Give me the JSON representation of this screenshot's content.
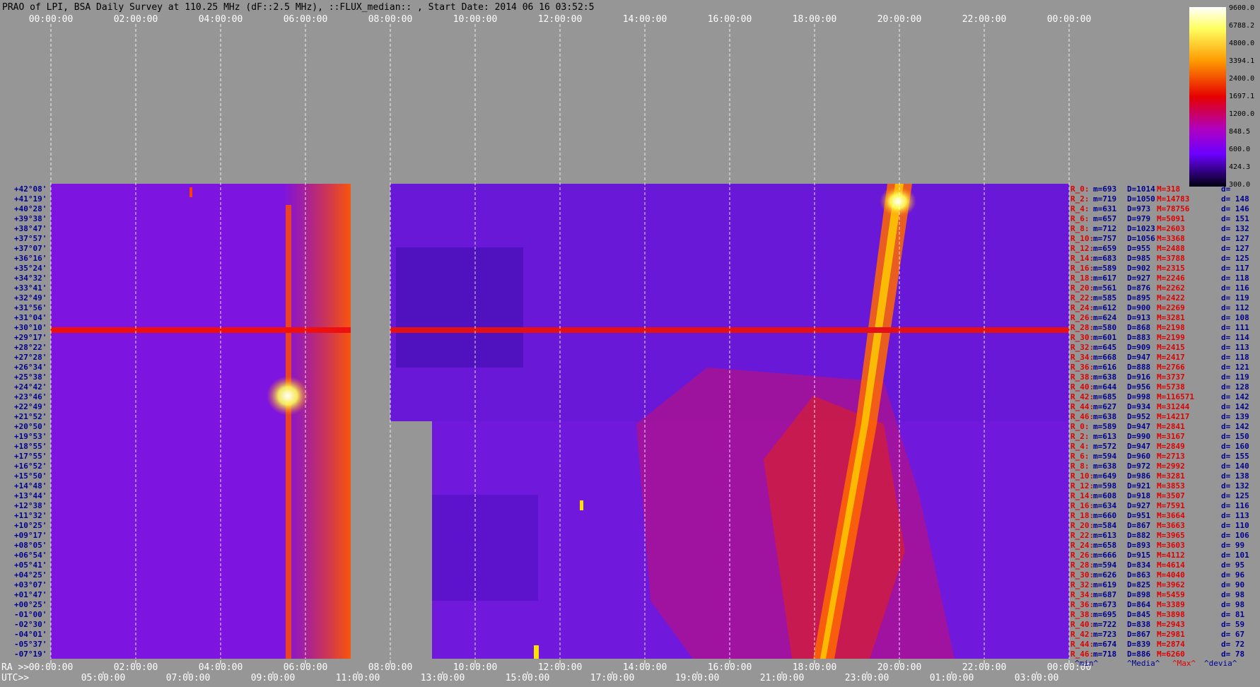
{
  "title": "PRAO of LPI, BSA Daily Survey at 110.25 MHz (dF::2.5 MHz), ::FLUX_median:: , Start Date: 2014 06 16 03:52:5",
  "top_time_ticks": [
    "00:00:00",
    "02:00:00",
    "04:00:00",
    "06:00:00",
    "08:00:00",
    "10:00:00",
    "12:00:00",
    "14:00:00",
    "16:00:00",
    "18:00:00",
    "20:00:00",
    "22:00:00",
    "00:00:00"
  ],
  "bottom": {
    "ra_label": "RA >>",
    "utc_label": "UTC>>",
    "ra_ticks": [
      "00:00:00",
      "02:00:00",
      "04:00:00",
      "06:00:00",
      "08:00:00",
      "10:00:00",
      "12:00:00",
      "14:00:00",
      "16:00:00",
      "18:00:00",
      "20:00:00",
      "22:00:00",
      "00:00:00"
    ],
    "utc_ticks": [
      "05:00:00",
      "07:00:00",
      "09:00:00",
      "11:00:00",
      "13:00:00",
      "15:00:00",
      "17:00:00",
      "19:00:00",
      "21:00:00",
      "23:00:00",
      "01:00:00",
      "03:00:00"
    ]
  },
  "colorbar": {
    "labels": [
      "9600.0",
      "6788.2",
      "4800.0",
      "3394.1",
      "2400.0",
      "1697.1",
      "1200.0",
      "848.5",
      "600.0",
      "424.3",
      "300.0"
    ]
  },
  "stats_footer": {
    "min": "^min^",
    "median": "^Media^",
    "max": "^Max^",
    "devia": "^devia^"
  },
  "colors": {
    "background": "#969696",
    "blue_text": "#000090",
    "red_text": "#e00000",
    "grid": "#ffffff"
  },
  "chart_data": {
    "type": "heatmap",
    "title": "PRAO of LPI, BSA Daily Survey at 110.25 MHz (dF::2.5 MHz), ::FLUX_median:: , Start Date: 2014 06 16 03:52:5",
    "x_axis": "RA (hours), UTC shown below",
    "y_axis": "Declination",
    "color_scale": {
      "min": 300.0,
      "max": 9600.0,
      "scale": "log"
    },
    "declinations": [
      "+42°08'",
      "+41°19'",
      "+40°28'",
      "+39°38'",
      "+38°47'",
      "+37°57'",
      "+37°07'",
      "+36°16'",
      "+35°24'",
      "+34°32'",
      "+33°41'",
      "+32°49'",
      "+31°56'",
      "+31°04'",
      "+30°10'",
      "+29°17'",
      "+28°22'",
      "+27°28'",
      "+26°34'",
      "+25°38'",
      "+24°42'",
      "+23°46'",
      "+22°49'",
      "+21°52'",
      "+20°50'",
      "+19°53'",
      "+18°55'",
      "+17°55'",
      "+16°52'",
      "+15°50'",
      "+14°48'",
      "+13°44'",
      "+12°38'",
      "+11°32'",
      "+10°25'",
      "+09°17'",
      "+08°05'",
      "+06°54'",
      "+05°41'",
      "+04°25'",
      "+03°07'",
      "+01°47'",
      "+00°25'",
      "-01°00'",
      "-02°30'",
      "-04°01'",
      "-05°37'",
      "-07°19'"
    ],
    "beam_stats": [
      {
        "beam": "R_0:",
        "min": "m=693",
        "median": "D=1014",
        "max": "M=318",
        "devia": "d="
      },
      {
        "beam": "R_2:",
        "min": "m=719",
        "median": "D=1050",
        "max": "M=14783",
        "devia": "d= 148"
      },
      {
        "beam": "R_4:",
        "min": "m=631",
        "median": "D=973",
        "max": "M=78756",
        "devia": "d= 146"
      },
      {
        "beam": "R_6:",
        "min": "m=657",
        "median": "D=979",
        "max": "M=5091",
        "devia": "d= 151"
      },
      {
        "beam": "R_8:",
        "min": "m=712",
        "median": "D=1023",
        "max": "M=2603",
        "devia": "d= 132"
      },
      {
        "beam": "R_10:",
        "min": "m=757",
        "median": "D=1056",
        "max": "M=3368",
        "devia": "d= 127"
      },
      {
        "beam": "R_12:",
        "min": "m=659",
        "median": "D=955",
        "max": "M=2488",
        "devia": "d= 127"
      },
      {
        "beam": "R_14:",
        "min": "m=683",
        "median": "D=985",
        "max": "M=3788",
        "devia": "d= 125"
      },
      {
        "beam": "R_16:",
        "min": "m=589",
        "median": "D=902",
        "max": "M=2315",
        "devia": "d= 117"
      },
      {
        "beam": "R_18:",
        "min": "m=617",
        "median": "D=927",
        "max": "M=2246",
        "devia": "d= 118"
      },
      {
        "beam": "R_20:",
        "min": "m=561",
        "median": "D=876",
        "max": "M=2262",
        "devia": "d= 116"
      },
      {
        "beam": "R_22:",
        "min": "m=585",
        "median": "D=895",
        "max": "M=2422",
        "devia": "d= 119"
      },
      {
        "beam": "R_24:",
        "min": "m=612",
        "median": "D=900",
        "max": "M=2269",
        "devia": "d= 112"
      },
      {
        "beam": "R_26:",
        "min": "m=624",
        "median": "D=913",
        "max": "M=3281",
        "devia": "d= 108"
      },
      {
        "beam": "R_28:",
        "min": "m=580",
        "median": "D=868",
        "max": "M=2198",
        "devia": "d= 111"
      },
      {
        "beam": "R_30:",
        "min": "m=601",
        "median": "D=883",
        "max": "M=2199",
        "devia": "d= 114"
      },
      {
        "beam": "R_32:",
        "min": "m=645",
        "median": "D=909",
        "max": "M=2415",
        "devia": "d= 113"
      },
      {
        "beam": "R_34:",
        "min": "m=668",
        "median": "D=947",
        "max": "M=2417",
        "devia": "d= 118"
      },
      {
        "beam": "R_36:",
        "min": "m=616",
        "median": "D=888",
        "max": "M=2766",
        "devia": "d= 121"
      },
      {
        "beam": "R_38:",
        "min": "m=638",
        "median": "D=916",
        "max": "M=3737",
        "devia": "d= 119"
      },
      {
        "beam": "R_40:",
        "min": "m=644",
        "median": "D=956",
        "max": "M=5738",
        "devia": "d= 128"
      },
      {
        "beam": "R_42:",
        "min": "m=685",
        "median": "D=998",
        "max": "M=116571",
        "devia": "d= 142"
      },
      {
        "beam": "R_44:",
        "min": "m=627",
        "median": "D=934",
        "max": "M=31244",
        "devia": "d= 142"
      },
      {
        "beam": "R_46:",
        "min": "m=638",
        "median": "D=952",
        "max": "M=14217",
        "devia": "d= 139"
      },
      {
        "beam": "R_0:",
        "min": "m=589",
        "median": "D=947",
        "max": "M=2841",
        "devia": "d= 142"
      },
      {
        "beam": "R_2:",
        "min": "m=613",
        "median": "D=990",
        "max": "M=3167",
        "devia": "d= 150"
      },
      {
        "beam": "R_4:",
        "min": "m=572",
        "median": "D=947",
        "max": "M=2849",
        "devia": "d= 160"
      },
      {
        "beam": "R_6:",
        "min": "m=594",
        "median": "D=960",
        "max": "M=2713",
        "devia": "d= 155"
      },
      {
        "beam": "R_8:",
        "min": "m=638",
        "median": "D=972",
        "max": "M=2992",
        "devia": "d= 140"
      },
      {
        "beam": "R_10:",
        "min": "m=649",
        "median": "D=986",
        "max": "M=3281",
        "devia": "d= 138"
      },
      {
        "beam": "R_12:",
        "min": "m=598",
        "median": "D=921",
        "max": "M=3853",
        "devia": "d= 132"
      },
      {
        "beam": "R_14:",
        "min": "m=608",
        "median": "D=918",
        "max": "M=3507",
        "devia": "d= 125"
      },
      {
        "beam": "R_16:",
        "min": "m=634",
        "median": "D=927",
        "max": "M=7591",
        "devia": "d= 116"
      },
      {
        "beam": "R_18:",
        "min": "m=660",
        "median": "D=951",
        "max": "M=3664",
        "devia": "d= 113"
      },
      {
        "beam": "R_20:",
        "min": "m=584",
        "median": "D=867",
        "max": "M=3663",
        "devia": "d= 110"
      },
      {
        "beam": "R_22:",
        "min": "m=613",
        "median": "D=882",
        "max": "M=3965",
        "devia": "d= 106"
      },
      {
        "beam": "R_24:",
        "min": "m=658",
        "median": "D=893",
        "max": "M=3603",
        "devia": "d= 99"
      },
      {
        "beam": "R_26:",
        "min": "m=666",
        "median": "D=915",
        "max": "M=4112",
        "devia": "d= 101"
      },
      {
        "beam": "R_28:",
        "min": "m=594",
        "median": "D=834",
        "max": "M=4614",
        "devia": "d= 95"
      },
      {
        "beam": "R_30:",
        "min": "m=626",
        "median": "D=863",
        "max": "M=4040",
        "devia": "d= 96"
      },
      {
        "beam": "R_32:",
        "min": "m=619",
        "median": "D=825",
        "max": "M=3962",
        "devia": "d= 90"
      },
      {
        "beam": "R_34:",
        "min": "m=687",
        "median": "D=898",
        "max": "M=5459",
        "devia": "d= 98"
      },
      {
        "beam": "R_36:",
        "min": "m=673",
        "median": "D=864",
        "max": "M=3389",
        "devia": "d= 98"
      },
      {
        "beam": "R_38:",
        "min": "m=695",
        "median": "D=845",
        "max": "M=3898",
        "devia": "d= 81"
      },
      {
        "beam": "R_40:",
        "min": "m=722",
        "median": "D=838",
        "max": "M=2943",
        "devia": "d= 59"
      },
      {
        "beam": "R_42:",
        "min": "m=723",
        "median": "D=867",
        "max": "M=2981",
        "devia": "d= 67"
      },
      {
        "beam": "R_44:",
        "min": "m=674",
        "median": "D=839",
        "max": "M=2874",
        "devia": "d= 72"
      },
      {
        "beam": "R_46:",
        "min": "m=718",
        "median": "D=886",
        "max": "M=6260",
        "devia": "d= 78"
      }
    ]
  }
}
